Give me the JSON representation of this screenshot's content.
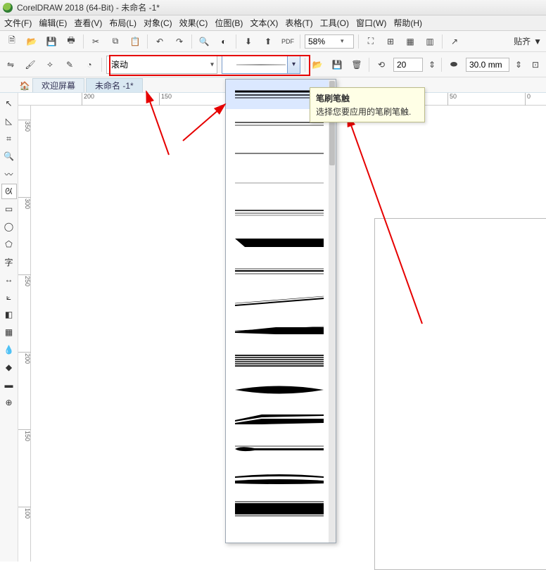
{
  "title": "CorelDRAW 2018 (64-Bit) - 未命名 -1*",
  "menu": {
    "file": "文件(F)",
    "edit": "编辑(E)",
    "view": "查看(V)",
    "layout": "布局(L)",
    "object": "对象(C)",
    "effect": "效果(C)",
    "bitmap": "位图(B)",
    "text": "文本(X)",
    "table": "表格(T)",
    "tools": "工具(O)",
    "window": "窗口(W)",
    "help": "帮助(H)"
  },
  "toolbar1": {
    "zoom_value": "58%",
    "snap_label": "贴齐",
    "snap_arrow": "▼"
  },
  "toolbar2": {
    "preset_label": "滚动",
    "angle_value": "20",
    "width_value": "30.0 mm"
  },
  "tabs": {
    "welcome": "欢迎屏幕",
    "doc": "未命名 -1*"
  },
  "tooltip": {
    "title": "笔刷笔触",
    "desc": "选择您要应用的笔刷笔触."
  },
  "ruler_h": {
    "t1": "200",
    "t2": "150",
    "t3": "50",
    "t4": "0"
  },
  "ruler_v": {
    "t1": "350",
    "t2": "300",
    "t3": "250",
    "t4": "200",
    "t5": "150",
    "t6": "100"
  }
}
